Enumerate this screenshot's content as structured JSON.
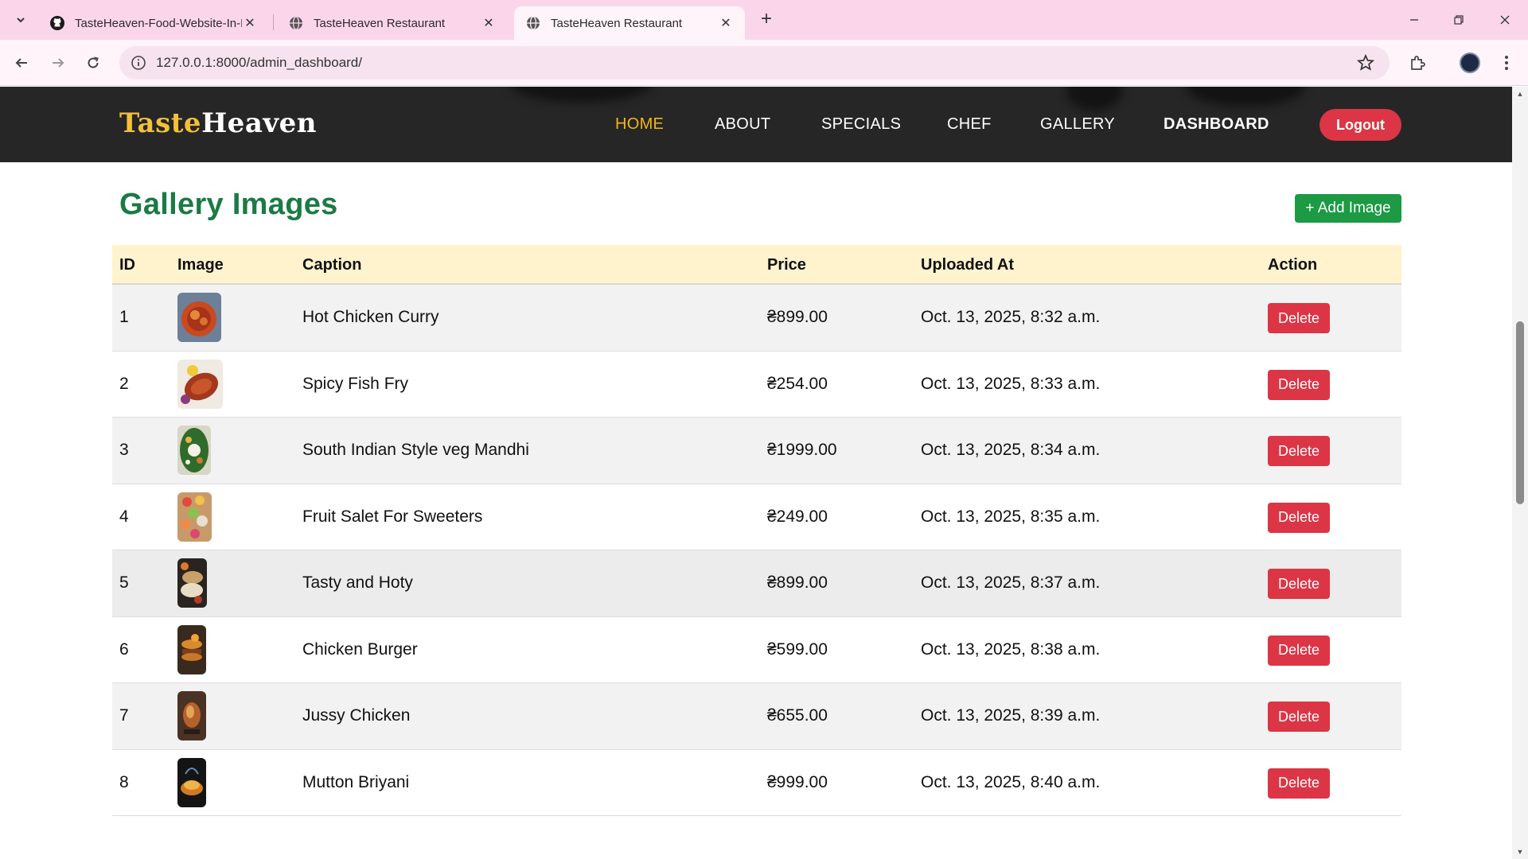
{
  "browser": {
    "tabs": [
      {
        "title": "TasteHeaven-Food-Website-In-D",
        "icon": "github-icon",
        "active": false
      },
      {
        "title": "TasteHeaven Restaurant",
        "icon": "globe-icon",
        "active": false
      },
      {
        "title": "TasteHeaven Restaurant",
        "icon": "globe-icon",
        "active": true
      }
    ],
    "url": "127.0.0.1:8000/admin_dashboard/",
    "new_tab": "+",
    "close": "✕"
  },
  "site": {
    "brand_part1": "Taste",
    "brand_part2": "Heaven",
    "nav": [
      "HOME",
      "ABOUT",
      "SPECIALS",
      "CHEF",
      "GALLERY",
      "DASHBOARD"
    ],
    "logout": "Logout"
  },
  "gallery": {
    "title": "Gallery Images",
    "add_button": "+ Add Image",
    "columns": [
      "ID",
      "Image",
      "Caption",
      "Price",
      "Uploaded At",
      "Action"
    ],
    "rows": [
      {
        "id": "1",
        "caption": "Hot Chicken Curry",
        "price": "₴899.00",
        "uploaded": "Oct. 13, 2025, 8:32 a.m.",
        "action": "Delete"
      },
      {
        "id": "2",
        "caption": "Spicy Fish Fry",
        "price": "₴254.00",
        "uploaded": "Oct. 13, 2025, 8:33 a.m.",
        "action": "Delete"
      },
      {
        "id": "3",
        "caption": "South Indian Style veg Mandhi",
        "price": "₴1999.00",
        "uploaded": "Oct. 13, 2025, 8:34 a.m.",
        "action": "Delete"
      },
      {
        "id": "4",
        "caption": "Fruit Salet For Sweeters",
        "price": "₴249.00",
        "uploaded": "Oct. 13, 2025, 8:35 a.m.",
        "action": "Delete"
      },
      {
        "id": "5",
        "caption": "Tasty and Hoty",
        "price": "₴899.00",
        "uploaded": "Oct. 13, 2025, 8:37 a.m.",
        "action": "Delete"
      },
      {
        "id": "6",
        "caption": "Chicken Burger",
        "price": "₴599.00",
        "uploaded": "Oct. 13, 2025, 8:38 a.m.",
        "action": "Delete"
      },
      {
        "id": "7",
        "caption": "Jussy Chicken",
        "price": "₴655.00",
        "uploaded": "Oct. 13, 2025, 8:39 a.m.",
        "action": "Delete"
      },
      {
        "id": "8",
        "caption": "Mutton Briyani",
        "price": "₴999.00",
        "uploaded": "Oct. 13, 2025, 8:40 a.m.",
        "action": "Delete"
      }
    ]
  },
  "colors": {
    "tab_strip": "#fbd6eb",
    "header_bg": "#262626",
    "brand_gold": "#f3c03a",
    "nav_active": "#f2b51b",
    "title_green": "#1b7a45",
    "add_green": "#1c9a44",
    "danger_red": "#dc3545",
    "table_head": "#fff3cd"
  }
}
